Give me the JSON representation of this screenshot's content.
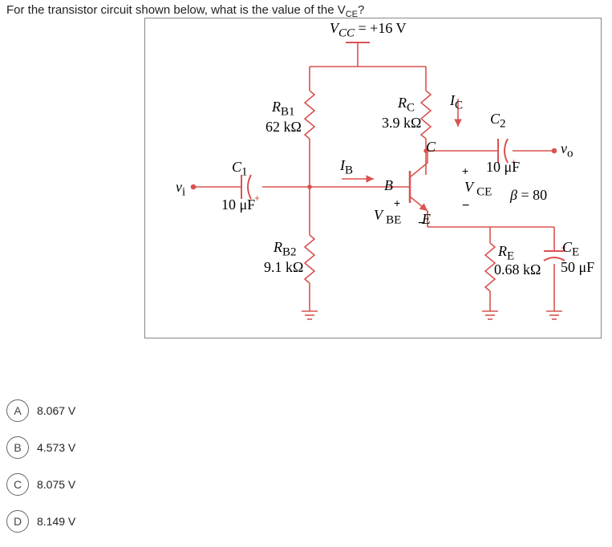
{
  "question": "For the transistor circuit shown below, what is the value of the V",
  "question_sub": "CE",
  "question_tail": "?",
  "circuit": {
    "vcc": "V_CC = +16 V",
    "rb1_name": "R_B1",
    "rb1_val": "62 kΩ",
    "rb2_name": "R_B2",
    "rb2_val": "9.1 kΩ",
    "rc_name": "R_C",
    "rc_val": "3.9 kΩ",
    "re_name": "R_E",
    "re_val": "0.68 kΩ",
    "c1_name": "C_1",
    "c1_val": "10 μF",
    "c2_name": "C_2",
    "c2_val": "10 μF",
    "ce_name": "C_E",
    "ce_val": "50 μF",
    "beta": "β = 80",
    "vi": "v_i",
    "vo": "v_o",
    "ib": "I_B",
    "ic": "I_C",
    "vce": "V CE",
    "vbe": "V BE",
    "node_b": "B",
    "node_c": "C",
    "node_e": "E"
  },
  "answers": {
    "a": "8.067 V",
    "b": "4.573 V",
    "c": "8.075 V",
    "d": "8.149 V"
  },
  "letters": {
    "a": "A",
    "b": "B",
    "c": "C",
    "d": "D"
  }
}
